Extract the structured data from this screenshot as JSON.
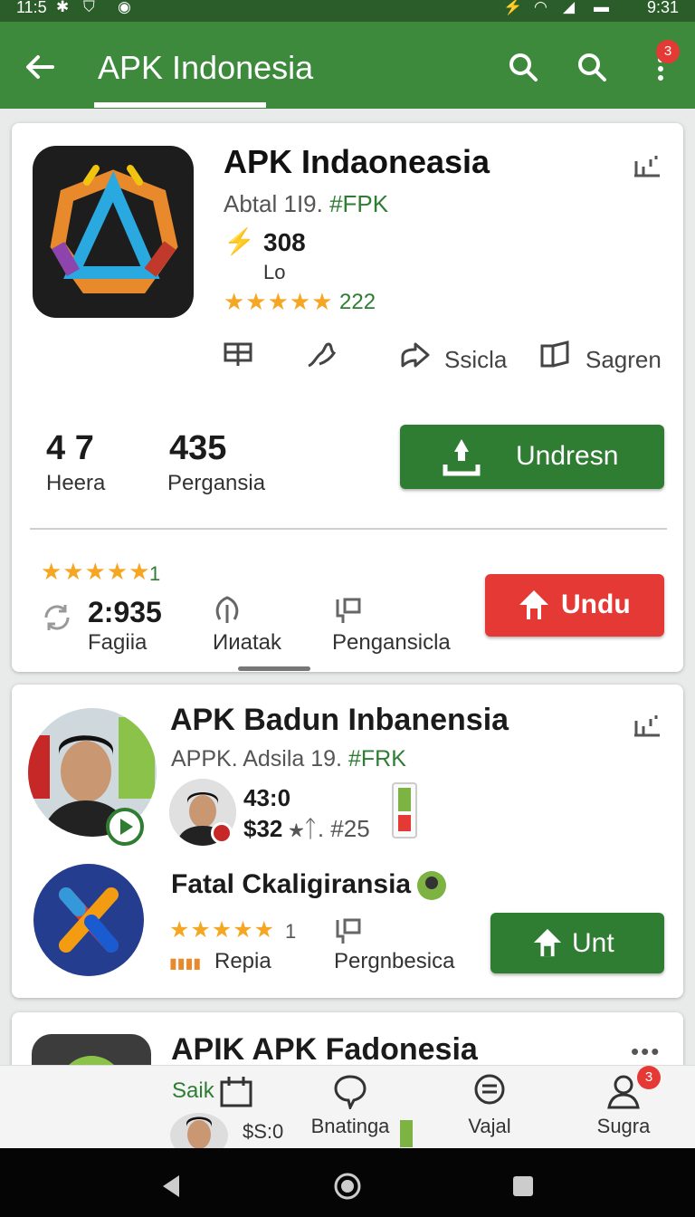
{
  "status": {
    "time_left": "11:5",
    "time_right": "9:31"
  },
  "appbar": {
    "title": "APK Indonesia",
    "menu_badge": "3"
  },
  "card1": {
    "title": "APK  Indaoneasia",
    "subtitle_plain": "Abtal  1I9.",
    "subtitle_tag": "#FPK",
    "metric": "308",
    "metric_sub": "Lo",
    "stars": "★★★★★",
    "rating_count": "222",
    "action_share": "Ssicla",
    "action_save": "Sagren",
    "stat1_value": "4 7",
    "stat1_label": "Heera",
    "stat2_value": "435",
    "stat2_label": "Pergansia",
    "primary_button": "Undresn",
    "row2_stars": "★★★★★",
    "row2_star_count": "1",
    "row2_value": "2:935",
    "row2_label": "Fagiia",
    "row2_label2": "Ииatak",
    "row2_label3": "Pengansicla",
    "secondary_button": "Undu"
  },
  "card2": {
    "title": "APK Badun Inbanensia",
    "subtitle_plain": "APPK.  Adsila 19.",
    "subtitle_tag": "#FRK",
    "metric1": "43:0",
    "metric2": "$32",
    "metric2_tail": "★ᛏ. #25",
    "item2_title": "Fatal Ckaligiransia",
    "item2_stars": "★★★★★",
    "item2_star_count": "1",
    "item2_label": "Repia",
    "item2_label2": "Pergnbesica",
    "item2_button": "Unt"
  },
  "card3": {
    "title": "APIK APK Fadonesia",
    "subtitle": "Saik",
    "metric": "$S:0"
  },
  "bottom_nav": {
    "items": [
      {
        "label": ""
      },
      {
        "label": "Bnatinga"
      },
      {
        "label": "Vajal"
      },
      {
        "label": "Sugra",
        "badge": "3"
      }
    ]
  },
  "colors": {
    "primary": "#3d8a3d",
    "accent_green": "#2e7d32",
    "accent_red": "#e53935",
    "star": "#f5a623"
  }
}
